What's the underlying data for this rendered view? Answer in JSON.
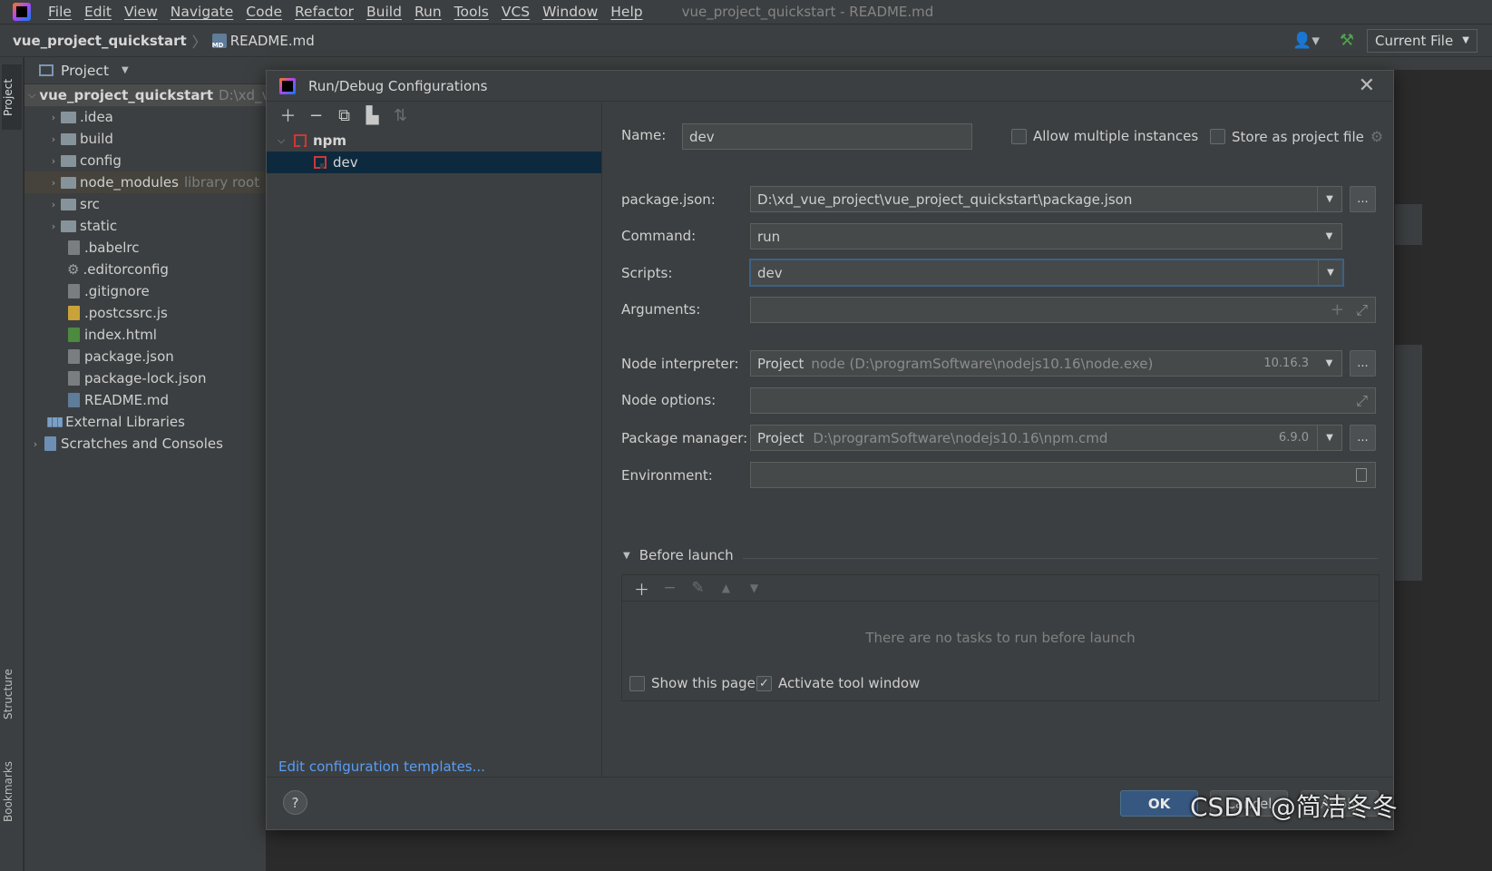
{
  "menubar": {
    "items": [
      "File",
      "Edit",
      "View",
      "Navigate",
      "Code",
      "Refactor",
      "Build",
      "Run",
      "Tools",
      "VCS",
      "Window",
      "Help"
    ],
    "window_title": "vue_project_quickstart - README.md"
  },
  "navbar": {
    "project": "vue_project_quickstart",
    "file": "README.md",
    "run_config_selector": "Current File"
  },
  "tool_strip": {
    "project": "Project",
    "structure": "Structure",
    "bookmarks": "Bookmarks"
  },
  "project_pane": {
    "header": "Project",
    "root_name": "vue_project_quickstart",
    "root_path": "D:\\xd_v",
    "items": [
      {
        "label": "idea",
        "display": ".idea"
      },
      {
        "label": "build"
      },
      {
        "label": "config"
      },
      {
        "label": "node_modules",
        "suffix": "library root"
      },
      {
        "label": "src"
      },
      {
        "label": "static"
      },
      {
        "label": ".babelrc"
      },
      {
        "label": ".editorconfig"
      },
      {
        "label": ".gitignore"
      },
      {
        "label": ".postcssrc.js"
      },
      {
        "label": "index.html"
      },
      {
        "label": "package.json"
      },
      {
        "label": "package-lock.json"
      },
      {
        "label": "README.md"
      },
      {
        "label": "External Libraries"
      },
      {
        "label": "Scratches and Consoles"
      }
    ]
  },
  "dialog": {
    "title": "Run/Debug Configurations",
    "tree": {
      "group": "npm",
      "config": "dev"
    },
    "edit_templates_link": "Edit configuration templates...",
    "form": {
      "name_label": "Name:",
      "name_value": "dev",
      "allow_multiple": "Allow multiple instances",
      "store_as_project": "Store as project file",
      "package_json_label": "package.json:",
      "package_json_value": "D:\\xd_vue_project\\vue_project_quickstart\\package.json",
      "command_label": "Command:",
      "command_value": "run",
      "scripts_label": "Scripts:",
      "scripts_value": "dev",
      "arguments_label": "Arguments:",
      "node_interpreter_label": "Node interpreter:",
      "node_interpreter_kind": "Project",
      "node_interpreter_path": "node (D:\\programSoftware\\nodejs10.16\\node.exe)",
      "node_interpreter_version": "10.16.3",
      "node_options_label": "Node options:",
      "package_manager_label": "Package manager:",
      "package_manager_kind": "Project",
      "package_manager_path": "D:\\programSoftware\\nodejs10.16\\npm.cmd",
      "package_manager_version": "6.9.0",
      "environment_label": "Environment:",
      "dots": "...",
      "before_launch_title": "Before launch",
      "before_launch_empty": "There are no tasks to run before launch",
      "show_this_page": "Show this page",
      "activate_tool_window": "Activate tool window"
    },
    "footer": {
      "help": "?",
      "ok": "OK",
      "cancel": "Cancel",
      "apply": "Apply"
    }
  },
  "watermark": "CSDN @简洁冬冬",
  "colors": {
    "accent_blue": "#365880",
    "link": "#589df6",
    "selection": "#0d293e",
    "npm_red": "#cb3837"
  }
}
